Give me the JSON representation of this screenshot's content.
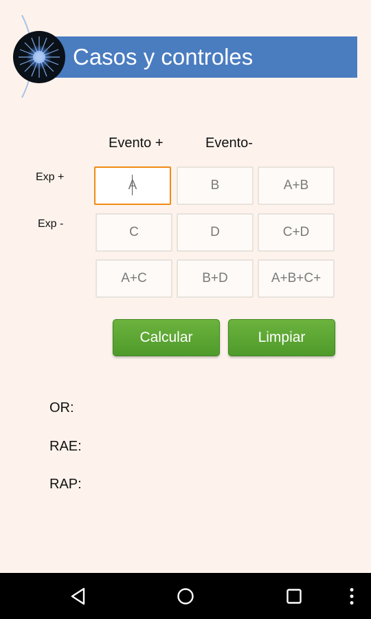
{
  "header": {
    "title": "Casos y controles"
  },
  "table": {
    "col_headers": [
      "Evento +",
      "Evento-"
    ],
    "row_headers": [
      "Exp +",
      "Exp -"
    ],
    "cells": [
      [
        "A",
        "B",
        "A+B"
      ],
      [
        "C",
        "D",
        "C+D"
      ],
      [
        "A+C",
        "B+D",
        "A+B+C+"
      ]
    ]
  },
  "actions": {
    "calcular_label": "Calcular",
    "limpiar_label": "Limpiar"
  },
  "results": {
    "or_label": "OR:",
    "rae_label": "RAE:",
    "rap_label": "RAP:"
  },
  "colors": {
    "accent": "#4a7cc0",
    "button": "#5aa533",
    "focus": "#f08a12",
    "background": "#fdf3ec"
  },
  "nav": {
    "icons": [
      "back-icon",
      "home-icon",
      "recents-icon",
      "overflow-menu-icon"
    ]
  }
}
